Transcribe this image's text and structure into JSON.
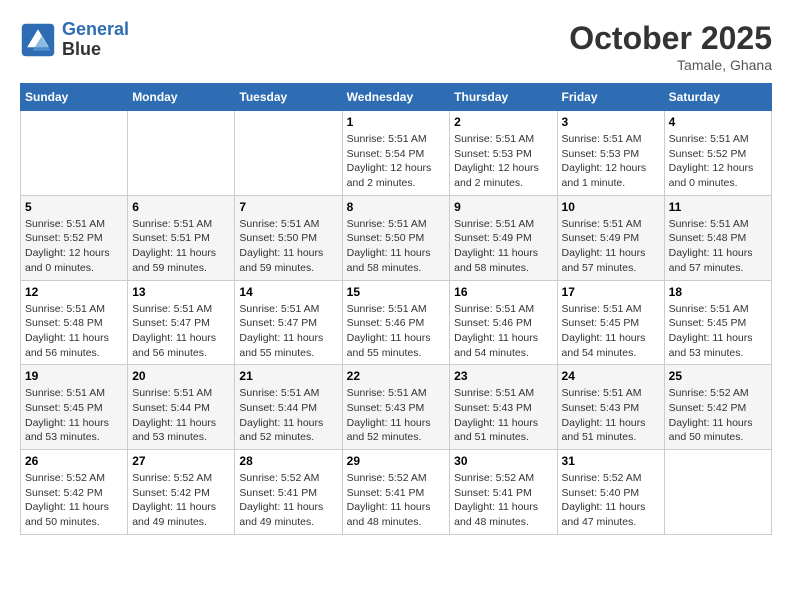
{
  "header": {
    "logo_line1": "General",
    "logo_line2": "Blue",
    "month": "October 2025",
    "location": "Tamale, Ghana"
  },
  "weekdays": [
    "Sunday",
    "Monday",
    "Tuesday",
    "Wednesday",
    "Thursday",
    "Friday",
    "Saturday"
  ],
  "weeks": [
    [
      {
        "day": "",
        "info": ""
      },
      {
        "day": "",
        "info": ""
      },
      {
        "day": "",
        "info": ""
      },
      {
        "day": "1",
        "info": "Sunrise: 5:51 AM\nSunset: 5:54 PM\nDaylight: 12 hours and 2 minutes."
      },
      {
        "day": "2",
        "info": "Sunrise: 5:51 AM\nSunset: 5:53 PM\nDaylight: 12 hours and 2 minutes."
      },
      {
        "day": "3",
        "info": "Sunrise: 5:51 AM\nSunset: 5:53 PM\nDaylight: 12 hours and 1 minute."
      },
      {
        "day": "4",
        "info": "Sunrise: 5:51 AM\nSunset: 5:52 PM\nDaylight: 12 hours and 0 minutes."
      }
    ],
    [
      {
        "day": "5",
        "info": "Sunrise: 5:51 AM\nSunset: 5:52 PM\nDaylight: 12 hours and 0 minutes."
      },
      {
        "day": "6",
        "info": "Sunrise: 5:51 AM\nSunset: 5:51 PM\nDaylight: 11 hours and 59 minutes."
      },
      {
        "day": "7",
        "info": "Sunrise: 5:51 AM\nSunset: 5:50 PM\nDaylight: 11 hours and 59 minutes."
      },
      {
        "day": "8",
        "info": "Sunrise: 5:51 AM\nSunset: 5:50 PM\nDaylight: 11 hours and 58 minutes."
      },
      {
        "day": "9",
        "info": "Sunrise: 5:51 AM\nSunset: 5:49 PM\nDaylight: 11 hours and 58 minutes."
      },
      {
        "day": "10",
        "info": "Sunrise: 5:51 AM\nSunset: 5:49 PM\nDaylight: 11 hours and 57 minutes."
      },
      {
        "day": "11",
        "info": "Sunrise: 5:51 AM\nSunset: 5:48 PM\nDaylight: 11 hours and 57 minutes."
      }
    ],
    [
      {
        "day": "12",
        "info": "Sunrise: 5:51 AM\nSunset: 5:48 PM\nDaylight: 11 hours and 56 minutes."
      },
      {
        "day": "13",
        "info": "Sunrise: 5:51 AM\nSunset: 5:47 PM\nDaylight: 11 hours and 56 minutes."
      },
      {
        "day": "14",
        "info": "Sunrise: 5:51 AM\nSunset: 5:47 PM\nDaylight: 11 hours and 55 minutes."
      },
      {
        "day": "15",
        "info": "Sunrise: 5:51 AM\nSunset: 5:46 PM\nDaylight: 11 hours and 55 minutes."
      },
      {
        "day": "16",
        "info": "Sunrise: 5:51 AM\nSunset: 5:46 PM\nDaylight: 11 hours and 54 minutes."
      },
      {
        "day": "17",
        "info": "Sunrise: 5:51 AM\nSunset: 5:45 PM\nDaylight: 11 hours and 54 minutes."
      },
      {
        "day": "18",
        "info": "Sunrise: 5:51 AM\nSunset: 5:45 PM\nDaylight: 11 hours and 53 minutes."
      }
    ],
    [
      {
        "day": "19",
        "info": "Sunrise: 5:51 AM\nSunset: 5:45 PM\nDaylight: 11 hours and 53 minutes."
      },
      {
        "day": "20",
        "info": "Sunrise: 5:51 AM\nSunset: 5:44 PM\nDaylight: 11 hours and 53 minutes."
      },
      {
        "day": "21",
        "info": "Sunrise: 5:51 AM\nSunset: 5:44 PM\nDaylight: 11 hours and 52 minutes."
      },
      {
        "day": "22",
        "info": "Sunrise: 5:51 AM\nSunset: 5:43 PM\nDaylight: 11 hours and 52 minutes."
      },
      {
        "day": "23",
        "info": "Sunrise: 5:51 AM\nSunset: 5:43 PM\nDaylight: 11 hours and 51 minutes."
      },
      {
        "day": "24",
        "info": "Sunrise: 5:51 AM\nSunset: 5:43 PM\nDaylight: 11 hours and 51 minutes."
      },
      {
        "day": "25",
        "info": "Sunrise: 5:52 AM\nSunset: 5:42 PM\nDaylight: 11 hours and 50 minutes."
      }
    ],
    [
      {
        "day": "26",
        "info": "Sunrise: 5:52 AM\nSunset: 5:42 PM\nDaylight: 11 hours and 50 minutes."
      },
      {
        "day": "27",
        "info": "Sunrise: 5:52 AM\nSunset: 5:42 PM\nDaylight: 11 hours and 49 minutes."
      },
      {
        "day": "28",
        "info": "Sunrise: 5:52 AM\nSunset: 5:41 PM\nDaylight: 11 hours and 49 minutes."
      },
      {
        "day": "29",
        "info": "Sunrise: 5:52 AM\nSunset: 5:41 PM\nDaylight: 11 hours and 48 minutes."
      },
      {
        "day": "30",
        "info": "Sunrise: 5:52 AM\nSunset: 5:41 PM\nDaylight: 11 hours and 48 minutes."
      },
      {
        "day": "31",
        "info": "Sunrise: 5:52 AM\nSunset: 5:40 PM\nDaylight: 11 hours and 47 minutes."
      },
      {
        "day": "",
        "info": ""
      }
    ]
  ]
}
